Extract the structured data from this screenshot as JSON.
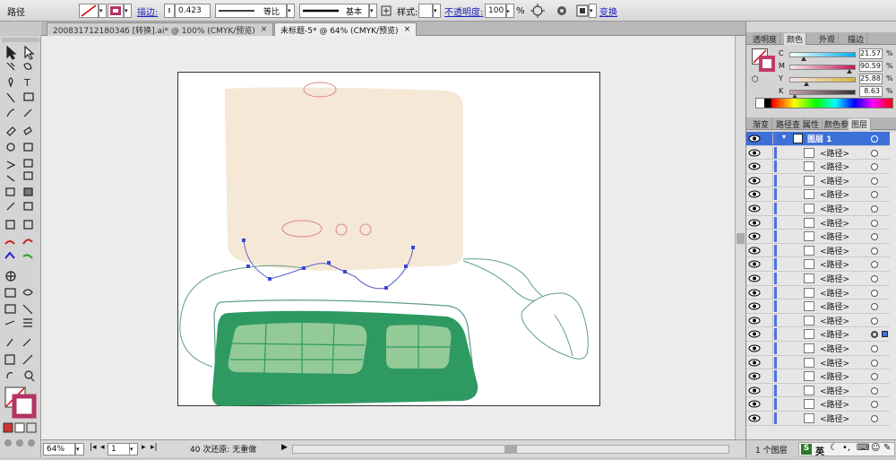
{
  "control_bar": {
    "object_type": "路径",
    "stroke_label": "描边:",
    "stroke_weight": "0.423",
    "profile_label": "等比",
    "brush_label": "基本",
    "style_label": "样式:",
    "opacity_label": "不透明度:",
    "opacity_value": "100",
    "opacity_unit": "%",
    "transform_link": "变换"
  },
  "document_tabs": [
    {
      "label": "20083171218034б [转换].ai* @ 100% (CMYK/预览)",
      "active": false
    },
    {
      "label": "未标题-5* @ 64% (CMYK/预览)",
      "active": true
    }
  ],
  "artwork": {
    "design_text": "DESIGN",
    "colors": {
      "monitor": "#f6e8d6",
      "keyboard": "#2e9a62",
      "keys": "#9fcf9e",
      "outline": "#5f9c8a",
      "path_selected": "#5560c8",
      "pink": "#d98888"
    }
  },
  "status_bar": {
    "zoom": "64%",
    "page": "1",
    "undo_text": "40 次还原: 无重做"
  },
  "color_panel": {
    "tabs": [
      "透明度",
      "颜色",
      "外观",
      "描边"
    ],
    "active_tab": "颜色",
    "channels": [
      {
        "label": "C",
        "value": "21.57",
        "fraction": 0.2157
      },
      {
        "label": "M",
        "value": "90.59",
        "fraction": 0.9059
      },
      {
        "label": "Y",
        "value": "25.88",
        "fraction": 0.2588
      },
      {
        "label": "K",
        "value": "8.63",
        "fraction": 0.0863
      }
    ],
    "unit": "%",
    "fill_color": "#c13a6e"
  },
  "layers_panel": {
    "tabs": [
      "渐变",
      "路径查",
      "属性",
      "颜色参",
      "图层"
    ],
    "active_tab": "图层",
    "layer_name": "图层 1",
    "items": [
      "<路径>",
      "<路径>",
      "<路径>",
      "<路径>",
      "<路径>",
      "<路径>",
      "<路径>",
      "<路径>",
      "<路径>",
      "<路径>",
      "<路径>",
      "<路径>",
      "<路径>",
      "<路径>",
      "<路径>",
      "<路径>",
      "<路径>",
      "<路径>",
      "<路径>",
      "<路径>"
    ],
    "selected_index": 13,
    "footer_text": "1 个图层"
  },
  "ime": {
    "label": "英"
  }
}
